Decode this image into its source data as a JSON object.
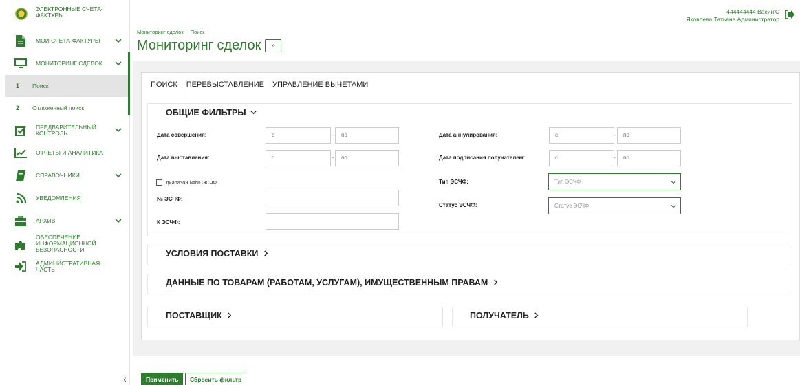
{
  "brand": {
    "title": "ЭЛЕКТРОННЫЕ СЧЕТА-ФАКТУРЫ"
  },
  "user": {
    "line1": "444444444 Васин'С",
    "line2": "Яковлева Татьяна Администратор"
  },
  "nav": {
    "items": [
      {
        "label": "МОИ СЧЕТА-ФАКТУРЫ",
        "icon": "document-icon"
      },
      {
        "label": "МОНИТОРИНГ СДЕЛОК",
        "icon": "monitor-icon"
      },
      {
        "label": "ПРЕДВАРИТЕЛЬНЫЙ КОНТРОЛЬ",
        "icon": "checkbox-icon"
      },
      {
        "label": "ОТЧЕТЫ И АНАЛИТИКА",
        "icon": "chart-icon"
      },
      {
        "label": "СПРАВОЧНИКИ",
        "icon": "book-icon"
      },
      {
        "label": "УВЕДОМЛЕНИЯ",
        "icon": "rss-icon"
      },
      {
        "label": "АРХИВ",
        "icon": "archive-icon"
      },
      {
        "label": "ОБЕСПЕЧЕНИЕ ИНФОРМАЦИОННОЙ БЕЗОПАСНОСТИ",
        "icon": "puzzle-icon"
      },
      {
        "label": "АДМИНИСТРАТИВНАЯ ЧАСТЬ",
        "icon": "sign-in-icon"
      }
    ],
    "sub": [
      {
        "num": "1",
        "label": "Поиск"
      },
      {
        "num": "2",
        "label": "Отложенный поиск"
      }
    ],
    "collapse": "‹"
  },
  "breadcrumb": {
    "item1": "Мониторинг сделок",
    "item2": "Поиск"
  },
  "page": {
    "title": "Мониторинг сделок",
    "toggle": "»"
  },
  "tabs": [
    "ПОИСК",
    "ПЕРЕВЫСТАВЛЕНИЕ",
    "УПРАВЛЕНИЕ ВЫЧЕТАМИ"
  ],
  "filters": {
    "title": "ОБЩИЕ ФИЛЬТРЫ",
    "date_done": "Дата совершения:",
    "date_issued": "Дата выставления:",
    "date_cancel": "Дата аннулирования:",
    "date_signed": "Дата подписания получателем:",
    "from": "с",
    "to": "по",
    "dash": "-",
    "range": "диапазон №№ ЭСЧФ",
    "num": "№ ЭСЧФ:",
    "k_num": "К ЭСЧФ:",
    "type_label": "Тип ЭСЧФ:",
    "type_placeholder": "Тип ЭСЧФ",
    "status_label": "Статус ЭСЧФ:",
    "status_placeholder": "Статус ЭСЧФ"
  },
  "sections": {
    "delivery": "УСЛОВИЯ ПОСТАВКИ",
    "goods": "ДАННЫЕ ПО ТОВАРАМ (РАБОТАМ, УСЛУГАМ), ИМУЩЕСТВЕННЫМ ПРАВАМ",
    "supplier": "ПОСТАВЩИК",
    "recipient": "ПОЛУЧАТЕЛЬ"
  },
  "buttons": {
    "apply": "Применить",
    "reset": "Сбросить фильтр"
  },
  "colors": {
    "accent": "#2e7d2e"
  }
}
